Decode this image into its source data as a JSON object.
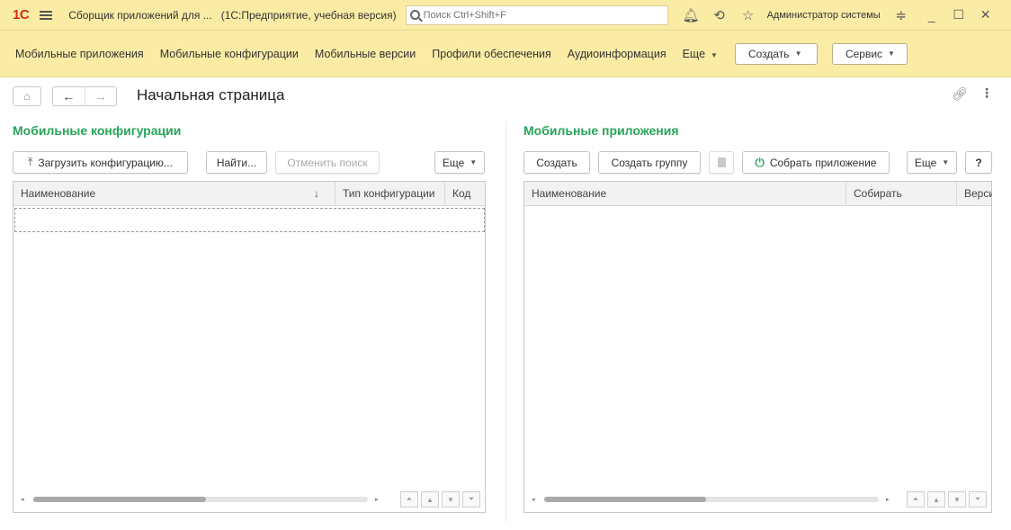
{
  "titlebar": {
    "logo": "1С",
    "app_title": "Сборщик приложений для ...",
    "app_subtitle": "(1С:Предприятие, учебная версия)",
    "search_placeholder": "Поиск Ctrl+Shift+F",
    "user": "Администратор системы",
    "icons": [
      "bell-icon",
      "history-icon",
      "star-icon",
      "settings-icon"
    ],
    "window_controls": [
      "_",
      "☐",
      "✕"
    ]
  },
  "menubar": {
    "items": [
      "Мобильные приложения",
      "Мобильные конфигурации",
      "Мобильные версии",
      "Профили обеспечения",
      "Аудиоинформация",
      "Еще"
    ],
    "create_label": "Создать",
    "service_label": "Сервис"
  },
  "page": {
    "title": "Начальная страница"
  },
  "left_panel": {
    "title": "Мобильные конфигурации",
    "buttons": {
      "upload": "Загрузить конфигурацию...",
      "find": "Найти...",
      "cancel_search": "Отменить поиск",
      "more": "Еще"
    },
    "columns": [
      "Наименование",
      "Тип конфигурации",
      "Код"
    ],
    "sort_indicator": "↓",
    "rows": []
  },
  "right_panel": {
    "title": "Мобильные приложения",
    "buttons": {
      "create": "Создать",
      "create_group": "Создать группу",
      "build": "Собрать приложение",
      "more": "Еще",
      "help": "?"
    },
    "columns": [
      "Наименование",
      "Собирать",
      "Верси"
    ],
    "rows": []
  },
  "colors": {
    "accent_green": "#28a35a",
    "toolbar_yellow": "#fbeca5",
    "logo_red": "#d42a1e"
  }
}
